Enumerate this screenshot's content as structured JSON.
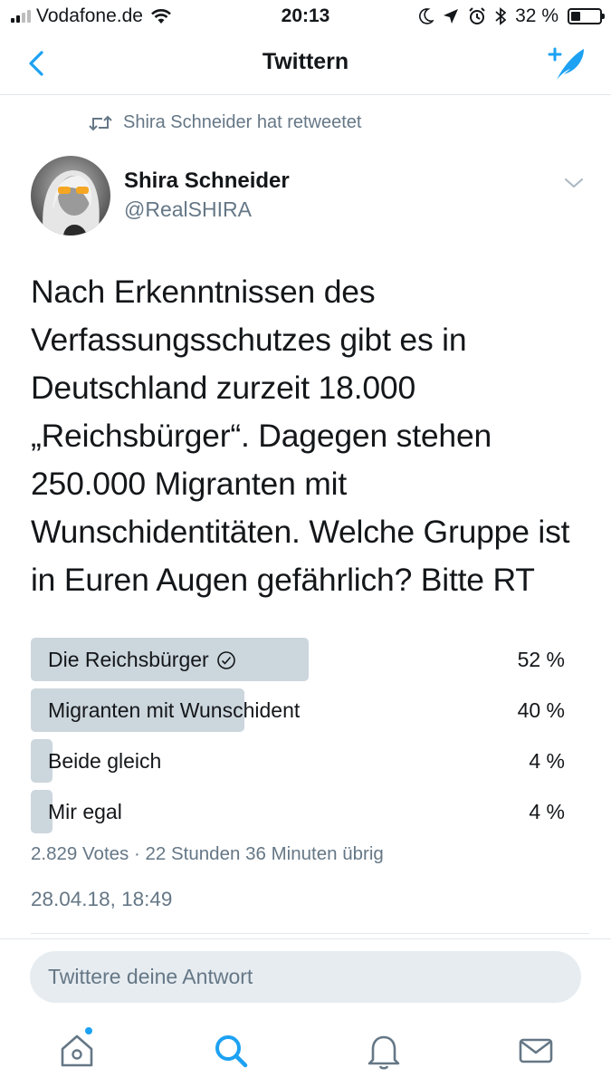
{
  "status_bar": {
    "carrier": "Vodafone.de",
    "time": "20:13",
    "battery_percent": "32 %",
    "battery_level": 0.32,
    "signal_bars": 2,
    "icons": [
      "signal-icon",
      "wifi-icon",
      "moon-icon",
      "location-arrow-icon",
      "alarm-icon",
      "bluetooth-icon",
      "battery-icon"
    ]
  },
  "nav": {
    "title": "Twittern",
    "back_icon": "chevron-left-icon",
    "compose_icon": "compose-tweet-icon"
  },
  "retweet": {
    "text": "Shira Schneider hat retweetet"
  },
  "tweet": {
    "author_name": "Shira Schneider",
    "author_handle": "@RealSHIRA",
    "text": "Nach Erkenntnissen des Verfassungsschutzes gibt es in Deutschland zurzeit 18.000 „Reichsbürger“. Dagegen stehen 250.000 Migranten mit Wunschidentitäten. Welche Gruppe ist in Euren Augen gefährlich? Bitte RT",
    "date": "28.04.18, 18:49"
  },
  "poll": {
    "options": [
      {
        "label": "Die Reichsbürger",
        "percent_label": "52 %",
        "percent": 52,
        "winner": true
      },
      {
        "label": "Migranten mit Wunschident",
        "percent_label": "40 %",
        "percent": 40,
        "winner": false
      },
      {
        "label": "Beide gleich",
        "percent_label": "4 %",
        "percent": 4,
        "winner": false
      },
      {
        "label": "Mir egal",
        "percent_label": "4 %",
        "percent": 4,
        "winner": false
      }
    ],
    "meta": "2.829 Votes · 22 Stunden 36 Minuten übrig"
  },
  "reply": {
    "placeholder": "Twittere deine Antwort"
  },
  "tabbar": {
    "items": [
      "home-icon",
      "search-icon",
      "notifications-icon",
      "messages-icon"
    ],
    "active": "search-icon",
    "accent": "#1da1f2"
  },
  "colors": {
    "accent": "#1da1f2",
    "secondary_text": "#657786",
    "poll_bar": "#ccd6dd"
  }
}
